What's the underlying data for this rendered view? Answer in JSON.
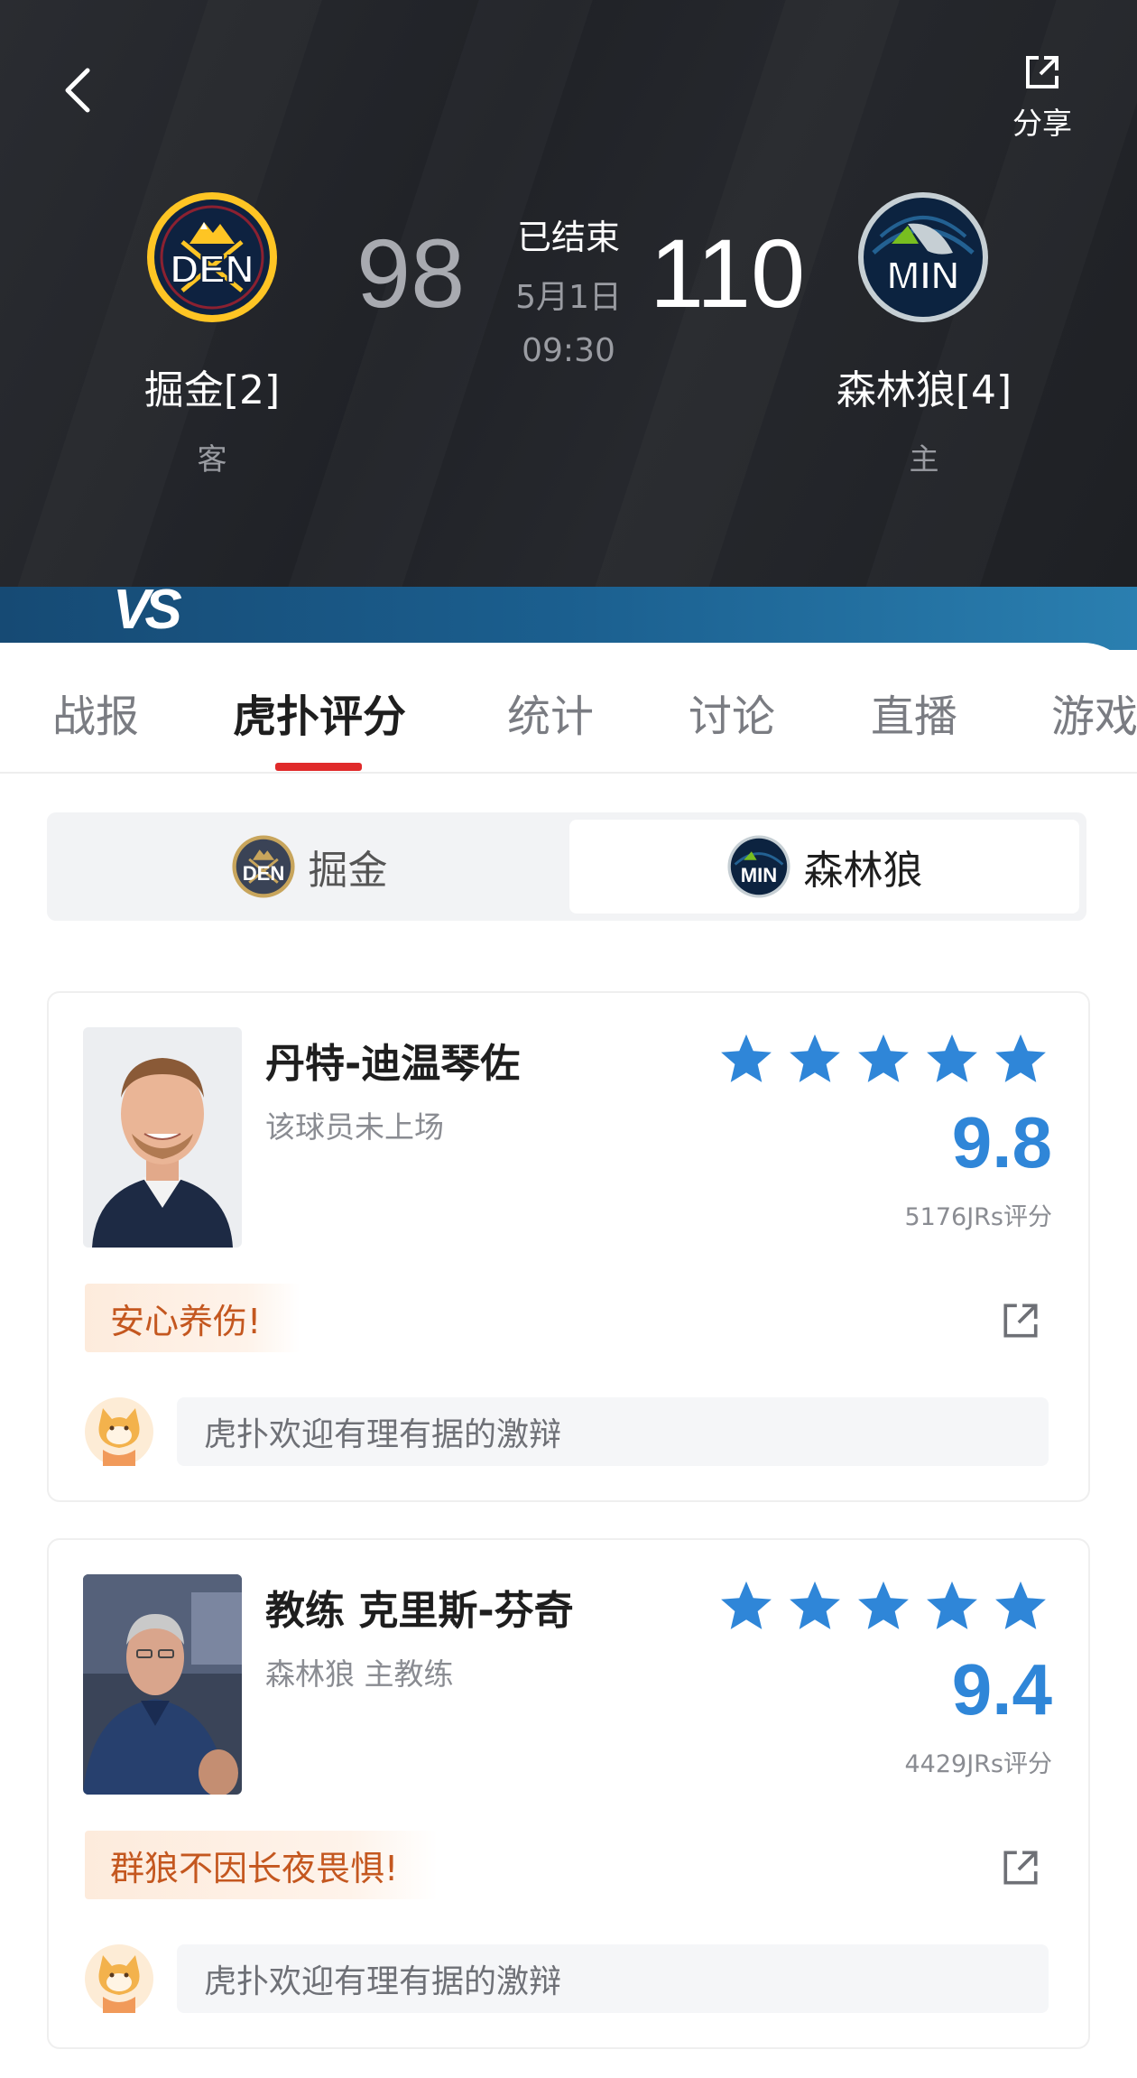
{
  "header": {
    "share_label": "分享",
    "status": "已结束",
    "date": "5月1日",
    "time": "09:30",
    "vs_label": "VS",
    "away": {
      "abbr": "DEN",
      "name": "掘金[2]",
      "side": "客",
      "score": "98",
      "color": "#0e2240",
      "accent": "#fec524"
    },
    "home": {
      "abbr": "MIN",
      "name": "森林狼[4]",
      "side": "主",
      "score": "110",
      "color": "#0c2340",
      "accent": "#78be20"
    }
  },
  "tabs": [
    {
      "label": "战报"
    },
    {
      "label": "虎扑评分"
    },
    {
      "label": "统计"
    },
    {
      "label": "讨论"
    },
    {
      "label": "直播"
    },
    {
      "label": "游戏"
    }
  ],
  "active_tab": "虎扑评分",
  "team_toggle": {
    "left": {
      "abbr": "DEN",
      "label": "掘金"
    },
    "right": {
      "abbr": "MIN",
      "label": "森林狼"
    },
    "selected": "森林狼"
  },
  "ratings": [
    {
      "name": "丹特-迪温琴佐",
      "subtitle": "该球员未上场",
      "stars": 5,
      "score": "9.8",
      "count": "5176JRs评分",
      "tag": "安心养伤!",
      "comment_placeholder": "虎扑欢迎有理有据的激辩"
    },
    {
      "name": "教练 克里斯-芬奇",
      "subtitle": "森林狼 主教练",
      "stars": 5,
      "score": "9.4",
      "count": "4429JRs评分",
      "tag": "群狼不因长夜畏惧!",
      "comment_placeholder": "虎扑欢迎有理有据的激辩"
    }
  ],
  "colors": {
    "accent_blue": "#2f86d8",
    "tab_indicator": "#e02a2a",
    "tag_text": "#c4571f"
  }
}
